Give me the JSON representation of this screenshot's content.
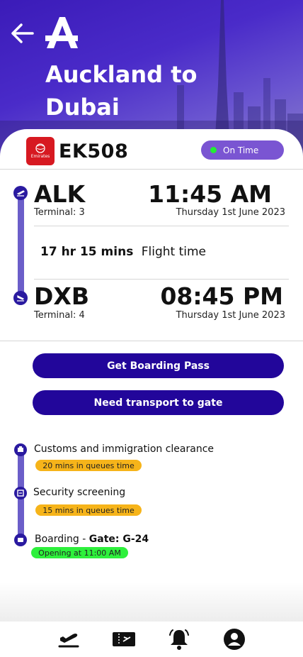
{
  "header": {
    "route_line1": "Auckland to",
    "route_line2": "Dubai"
  },
  "flight": {
    "number": "EK508",
    "airline_logo_text": "Emirates",
    "status": "On Time"
  },
  "departure": {
    "code": "ALK",
    "terminal": "Terminal: 3",
    "time": "11:45 AM",
    "date": "Thursday 1st June 2023"
  },
  "duration": {
    "value": "17 hr 15 mins",
    "label": "Flight time"
  },
  "arrival": {
    "code": "DXB",
    "terminal": "Terminal: 4",
    "time": "08:45 PM",
    "date": "Thursday 1st June 2023"
  },
  "actions": {
    "boarding_pass": "Get Boarding Pass",
    "transport": "Need transport to gate"
  },
  "steps": [
    {
      "title": "Customs and immigration clearance",
      "chip": "20 mins in queues time"
    },
    {
      "title": "Security screening",
      "chip": "15 mins in queues time"
    },
    {
      "title_prefix": "Boarding - ",
      "title_bold": "Gate: G-24",
      "chip": "Opening at 11:00 AM"
    }
  ],
  "colors": {
    "primary": "#22069a",
    "timeline": "#6b5ec9",
    "status_pill": "#7a55d2",
    "status_dot": "#22ee33",
    "amber_chip": "#f6b41a",
    "green_chip": "#2ef03c",
    "airline_red": "#d71921"
  },
  "nav": {
    "items": [
      "flights-icon",
      "ticket-icon",
      "bell-icon",
      "profile-icon"
    ]
  }
}
